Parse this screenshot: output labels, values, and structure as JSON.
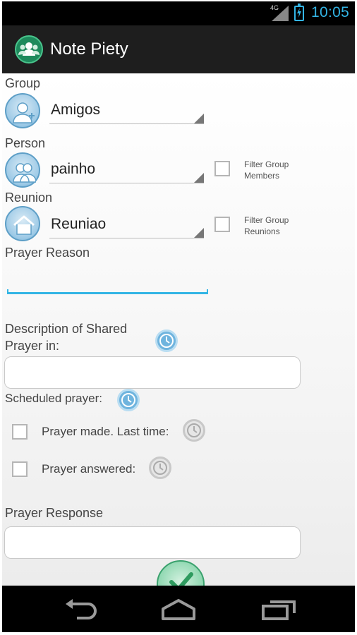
{
  "status_bar": {
    "network": "4G",
    "time": "10:05"
  },
  "app_bar": {
    "title": "Note Piety",
    "icon": "people-group-icon"
  },
  "form": {
    "group": {
      "label": "Group",
      "value": "Amigos"
    },
    "person": {
      "label": "Person",
      "value": "painho",
      "filter_label": "Filter Group Members",
      "filter_checked": false
    },
    "reunion": {
      "label": "Reunion",
      "value": "Reuniao",
      "filter_label": "Filter Group Reunions",
      "filter_checked": false
    },
    "prayer_reason": {
      "label": "Prayer Reason",
      "value": ""
    },
    "shared_description": {
      "label": "Description of Shared Prayer in:",
      "value": ""
    },
    "scheduled": {
      "label": "Scheduled prayer:"
    },
    "prayer_made": {
      "label": "Prayer made. Last time:",
      "checked": false
    },
    "prayer_answered": {
      "label": "Prayer answered:",
      "checked": false
    },
    "prayer_response": {
      "label": "Prayer Response",
      "value": ""
    }
  },
  "colors": {
    "accent": "#33b5e5",
    "confirm": "#3aa16d"
  },
  "nav_icons": [
    "back-icon",
    "home-icon",
    "recent-apps-icon"
  ]
}
